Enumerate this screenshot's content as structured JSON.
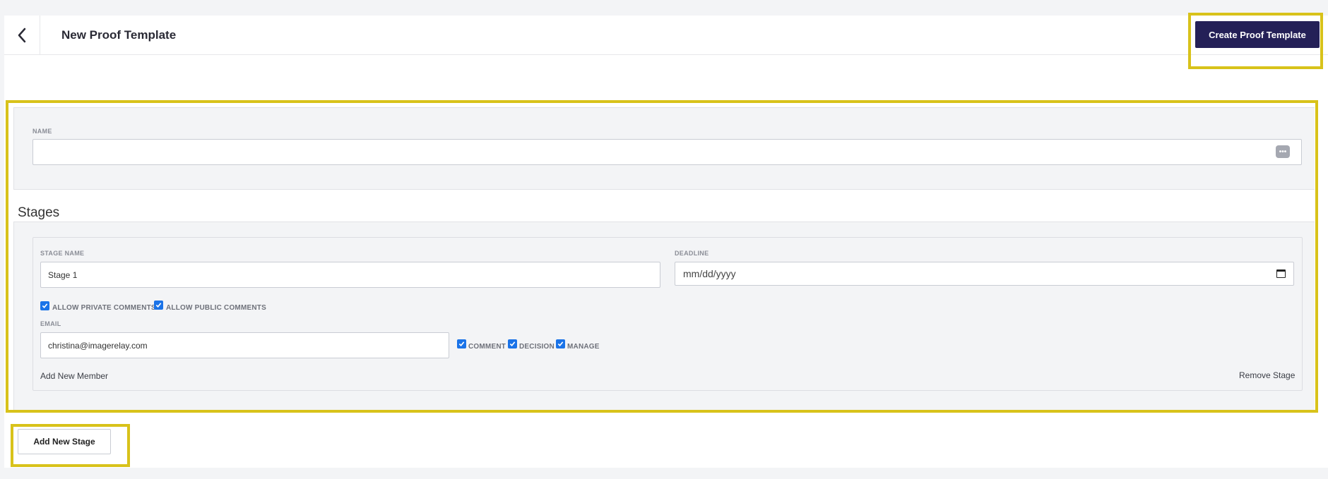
{
  "header": {
    "title": "New Proof Template",
    "back_icon": "chevron-left-icon",
    "create_button_label": "Create Proof Template"
  },
  "name_field": {
    "label": "NAME",
    "value": "",
    "password_manager_icon": "dots-icon"
  },
  "stages": {
    "title": "Stages",
    "items": [
      {
        "stage_name_label": "STAGE NAME",
        "stage_name_value": "Stage 1",
        "deadline_label": "DEADLINE",
        "deadline_placeholder": "mm/dd/yyyy",
        "allow_private_comments_label": "ALLOW PRIVATE COMMENTS",
        "allow_private_comments": true,
        "allow_public_comments_label": "ALLOW PUBLIC COMMENTS",
        "allow_public_comments": true,
        "email_label": "EMAIL",
        "email_value": "christina@imagerelay.com",
        "permissions": [
          {
            "label": "COMMENT",
            "checked": true
          },
          {
            "label": "DECISION",
            "checked": true
          },
          {
            "label": "MANAGE",
            "checked": true
          }
        ],
        "add_member_label": "Add New Member",
        "remove_stage_label": "Remove Stage"
      }
    ]
  },
  "add_stage_button_label": "Add New Stage",
  "colors": {
    "primary": "#242057",
    "highlight": "#d8c21a",
    "checkbox": "#1a73e8"
  }
}
